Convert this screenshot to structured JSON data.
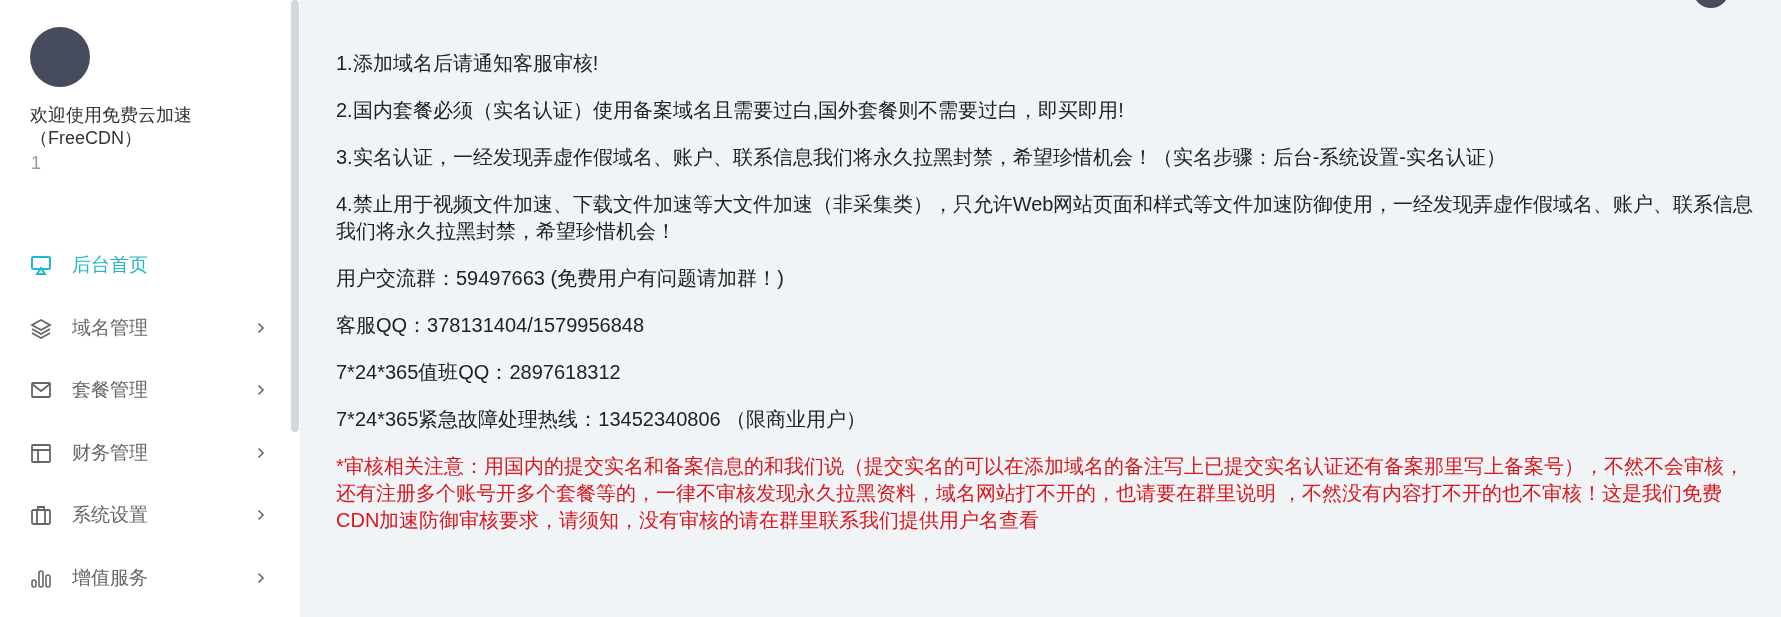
{
  "sidebar": {
    "welcome": "欢迎使用免费云加速（FreeCDN）",
    "user": "1",
    "menu": [
      {
        "label": "后台首页",
        "kind": "monitor",
        "selected": true,
        "expandable": false
      },
      {
        "label": "域名管理",
        "kind": "layers",
        "selected": false,
        "expandable": true
      },
      {
        "label": "套餐管理",
        "kind": "envelope",
        "selected": false,
        "expandable": true
      },
      {
        "label": "财务管理",
        "kind": "layout",
        "selected": false,
        "expandable": true
      },
      {
        "label": "系统设置",
        "kind": "briefcase",
        "selected": false,
        "expandable": true
      },
      {
        "label": "增值服务",
        "kind": "bars",
        "selected": false,
        "expandable": true
      }
    ]
  },
  "notices": [
    {
      "kind": "info",
      "text": "1.添加域名后请通知客服审核!"
    },
    {
      "kind": "info",
      "text": "2.国内套餐必须（实名认证）使用备案域名且需要过白,国外套餐则不需要过白，即买即用!"
    },
    {
      "kind": "info",
      "text": "3.实名认证，一经发现弄虚作假域名、账户、联系信息我们将永久拉黑封禁，希望珍惜机会！（实名步骤：后台-系统设置-实名认证）"
    },
    {
      "kind": "info",
      "text": "4.禁止用于视频文件加速、下载文件加速等大文件加速（非采集类），只允许Web网站页面和样式等文件加速防御使用，一经发现弄虚作假域名、账户、联系信息我们将永久拉黑封禁，希望珍惜机会！"
    },
    {
      "kind": "info",
      "text": "用户交流群：59497663 (免费用户有问题请加群！)"
    },
    {
      "kind": "info",
      "text": "客服QQ：378131404/1579956848"
    },
    {
      "kind": "info",
      "text": "7*24*365值班QQ：2897618312"
    },
    {
      "kind": "info",
      "text": "7*24*365紧急故障处理热线：13452340806 （限商业用户）"
    },
    {
      "kind": "warning",
      "text": "*审核相关注意：用国内的提交实名和备案信息的和我们说（提交实名的可以在添加域名的备注写上已提交实名认证还有备案那里写上备案号），不然不会审核，还有注册多个账号开多个套餐等的，一律不审核发现永久拉黑资料，域名网站打不开的，也请要在群里说明 ，不然没有内容打不开的也不审核！这是我们免费CDN加速防御审核要求，请须知，没有审核的请在群里联系我们提供用户名查看"
    }
  ]
}
